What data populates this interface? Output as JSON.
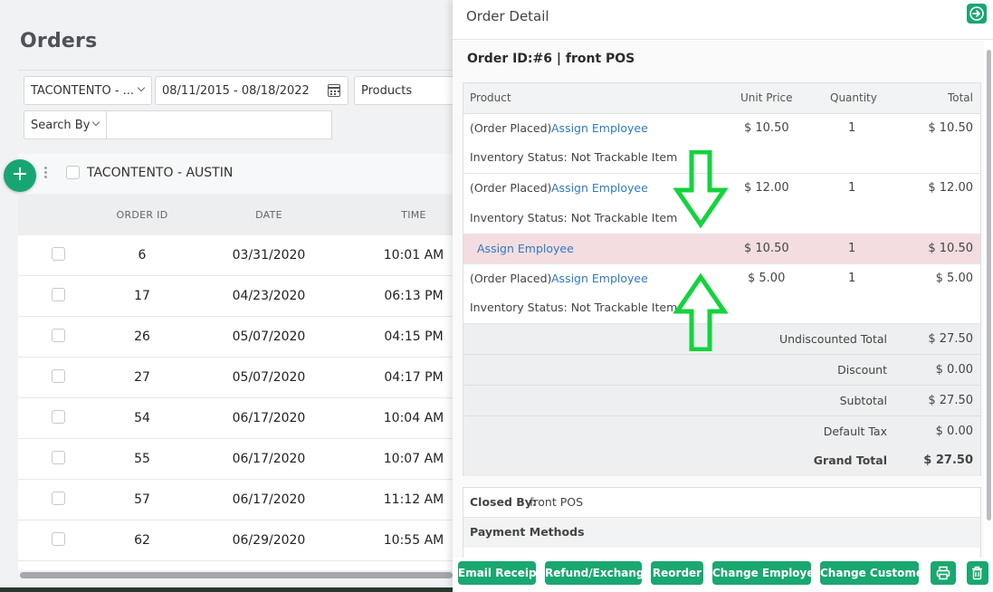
{
  "orders_page": {
    "title": "Orders",
    "location_filter": "TACONTENTO - ...",
    "date_range": "08/11/2015 - 08/18/2022",
    "products_filter": "Products",
    "search_by": "Search By",
    "group_label": "TACONTENTO - AUSTIN",
    "columns": [
      "ORDER ID",
      "DATE",
      "TIME"
    ],
    "rows": [
      {
        "id": "6",
        "date": "03/31/2020",
        "time": "10:01 AM"
      },
      {
        "id": "17",
        "date": "04/23/2020",
        "time": "06:13 PM"
      },
      {
        "id": "26",
        "date": "05/07/2020",
        "time": "04:15 PM"
      },
      {
        "id": "27",
        "date": "05/07/2020",
        "time": "04:17 PM"
      },
      {
        "id": "54",
        "date": "06/17/2020",
        "time": "10:04 AM"
      },
      {
        "id": "55",
        "date": "06/17/2020",
        "time": "10:07 AM"
      },
      {
        "id": "57",
        "date": "06/17/2020",
        "time": "11:12 AM"
      },
      {
        "id": "62",
        "date": "06/29/2020",
        "time": "10:55 AM"
      }
    ]
  },
  "panel": {
    "title": "Order Detail",
    "order_id_line": "Order ID:#6 | front POS",
    "columns": {
      "product": "Product",
      "unit_price": "Unit Price",
      "quantity": "Quantity",
      "total": "Total"
    },
    "items": [
      {
        "status": "(Order Placed)",
        "link": "Assign Employee",
        "unit_price": "$ 10.50",
        "qty": "1",
        "total": "$ 10.50",
        "inventory": "Inventory Status: Not Trackable Item"
      },
      {
        "status": "(Order Placed)",
        "link": "Assign Employee",
        "unit_price": "$ 12.00",
        "qty": "1",
        "total": "$ 12.00",
        "inventory": "Inventory Status: Not Trackable Item"
      },
      {
        "status": "",
        "link": "Assign Employee",
        "unit_price": "$ 10.50",
        "qty": "1",
        "total": "$ 10.50",
        "inventory": ""
      },
      {
        "status": "(Order Placed)",
        "link": "Assign Employee",
        "unit_price": "$ 5.00",
        "qty": "1",
        "total": "$ 5.00",
        "inventory": "Inventory Status: Not Trackable Item"
      }
    ],
    "summary": [
      {
        "label": "Undiscounted Total",
        "value": "$ 27.50"
      },
      {
        "label": "Discount",
        "value": "$ 0.00"
      },
      {
        "label": "Subtotal",
        "value": "$ 27.50"
      },
      {
        "label": "Default Tax",
        "value": "$ 0.00"
      },
      {
        "label": "Grand Total",
        "value": "$ 27.50"
      }
    ],
    "closed_by_label": "Closed By:",
    "closed_by_value": "front POS",
    "payment_methods": "Payment Methods",
    "buttons": {
      "email_receipt": "Email Receipt",
      "refund_exchange": "Refund/Exchange",
      "reorder": "Reorder",
      "change_employee": "Change Employee",
      "change_customer": "Change Customer"
    }
  },
  "colors": {
    "brand_green": "#1aa770",
    "highlight_row": "#f3dde0",
    "link_blue": "#2f7ac2",
    "annotation_arrow": "#12d43c"
  },
  "icons": {
    "exit": "arrow-right-icon",
    "print": "printer-icon",
    "delete": "trash-icon",
    "calendar": "calendar-icon",
    "add": "plus-icon"
  }
}
